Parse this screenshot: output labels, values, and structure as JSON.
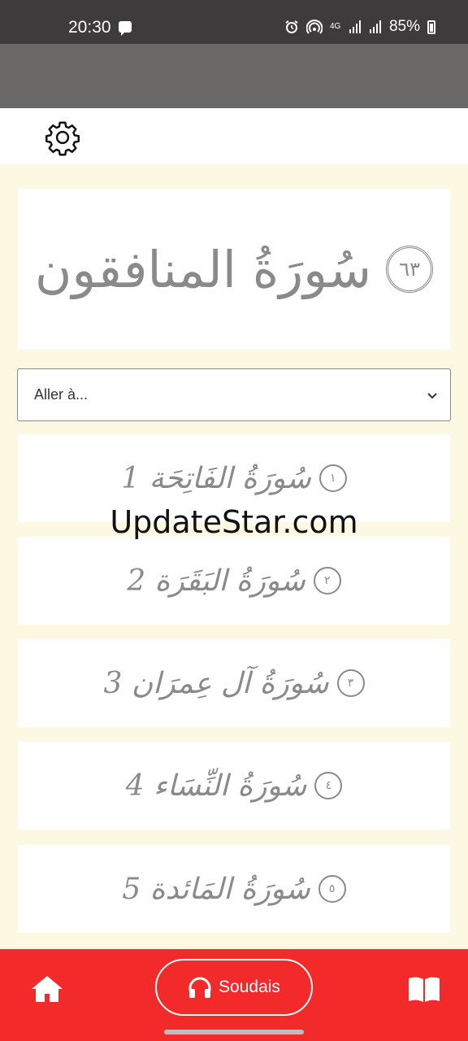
{
  "status_bar": {
    "time": "20:30",
    "network_label": "4G",
    "battery": "85%",
    "icons": [
      "message-icon",
      "alarm-icon",
      "hotspot-icon",
      "signal-icon",
      "battery-icon"
    ]
  },
  "toolbar": {
    "settings_icon": "gear-icon"
  },
  "title_card": {
    "surah_number": "٦٣",
    "surah_name": "سُورَةُ المنافقون"
  },
  "goto_select": {
    "label": "Aller à..."
  },
  "surah_list": [
    {
      "medallion": "١",
      "name": "سُورَةُ الفَاتِحَة 1"
    },
    {
      "medallion": "٢",
      "name": "سُورَةُ البَقَرَة 2"
    },
    {
      "medallion": "٣",
      "name": "سُورَةُ آل عِمرَان 3"
    },
    {
      "medallion": "٤",
      "name": "سُورَةُ النِّسَاء 4"
    },
    {
      "medallion": "٥",
      "name": "سُورَةُ المَائدة 5"
    }
  ],
  "watermark": "UpdateStar.com",
  "bottom_nav": {
    "audio_label": "Soudais",
    "home_icon": "home-icon",
    "audio_icon": "headphones-icon",
    "book_icon": "book-icon"
  },
  "colors": {
    "accent": "#f22a2a",
    "header": "#6a6767",
    "status_bar": "#3d3b3b",
    "background": "#fdf8e1",
    "text_gray": "#8a8a8a"
  }
}
